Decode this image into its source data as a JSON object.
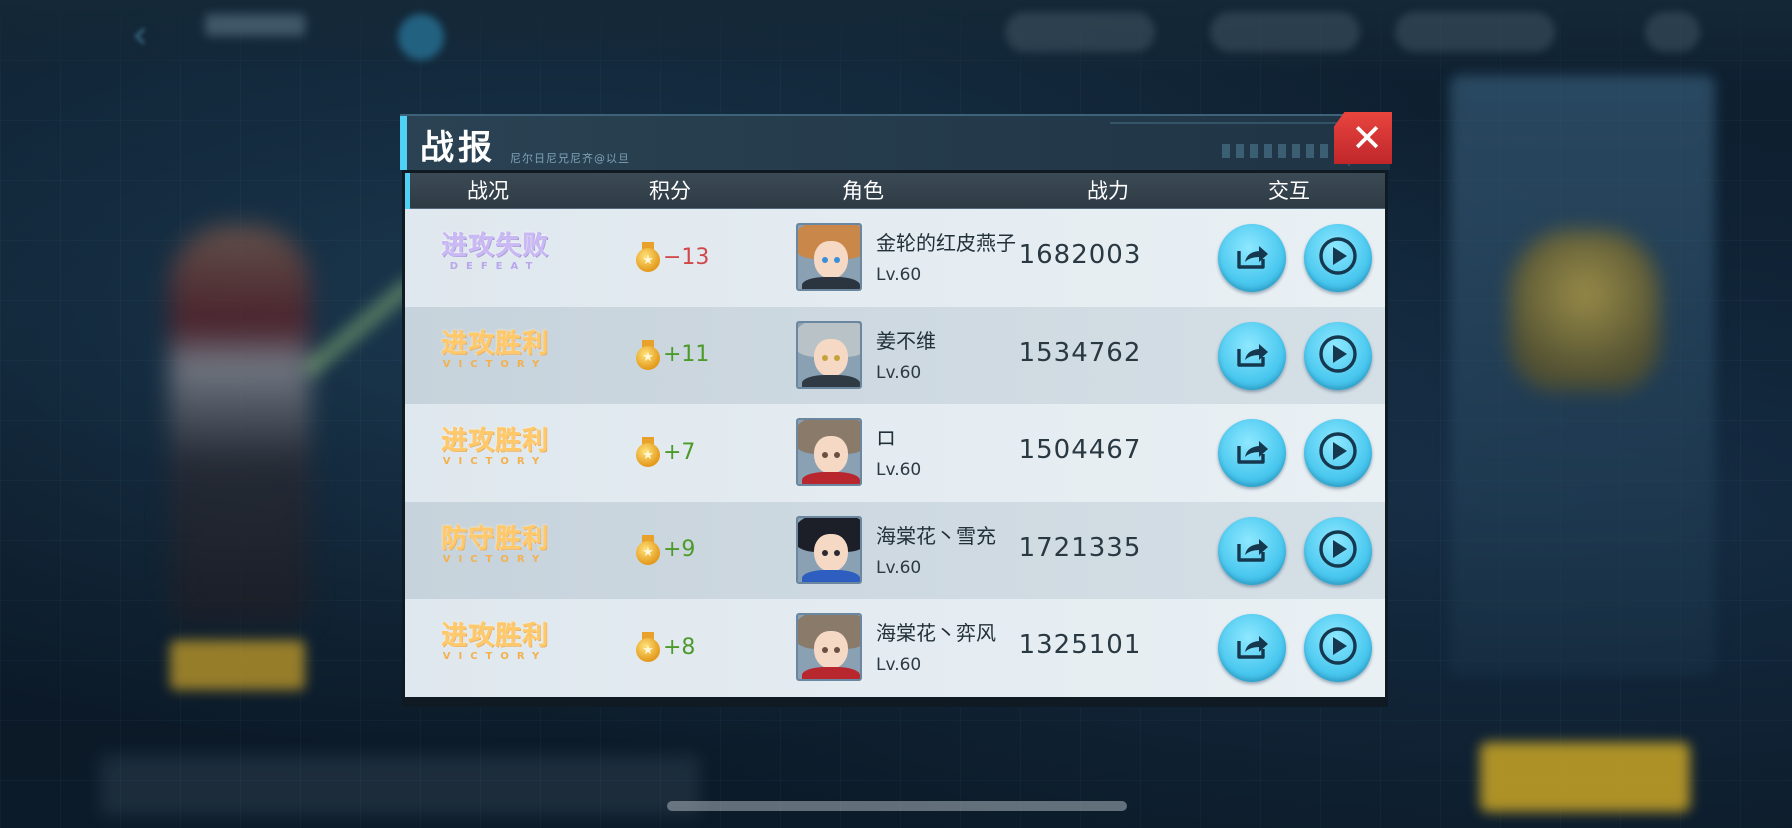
{
  "dialog": {
    "title": "战报",
    "subtitle": "尼尔日尼兄尼齐@以旦",
    "close_label": "✕"
  },
  "table": {
    "headers": [
      "战况",
      "积分",
      "角色",
      "战力",
      "交互"
    ],
    "rows": [
      {
        "result": "进攻失败",
        "result_sub": "DEFEAT",
        "result_type": "defeat",
        "score": "−13",
        "score_sign": "neg",
        "name": "金轮的红皮燕子",
        "level": "Lv.60",
        "power": "1682003",
        "avatar": {
          "hair": "#c9874a",
          "eye": "#3b8fd6",
          "body": "#2a3540"
        }
      },
      {
        "result": "进攻胜利",
        "result_sub": "VICTORY",
        "result_type": "victory",
        "score": "+11",
        "score_sign": "pos",
        "name": "姜不维",
        "level": "Lv.60",
        "power": "1534762",
        "avatar": {
          "hair": "#b9c2c6",
          "eye": "#c6a23a",
          "body": "#2f3a44"
        }
      },
      {
        "result": "进攻胜利",
        "result_sub": "VICTORY",
        "result_type": "victory",
        "score": "+7",
        "score_sign": "pos",
        "name": "ロ",
        "level": "Lv.60",
        "power": "1504467",
        "avatar": {
          "hair": "#8a7a6a",
          "eye": "#6a5040",
          "body": "#b8262e"
        }
      },
      {
        "result": "防守胜利",
        "result_sub": "VICTORY",
        "result_type": "victory",
        "score": "+9",
        "score_sign": "pos",
        "name": "海棠花丶雪充",
        "level": "Lv.60",
        "power": "1721335",
        "avatar": {
          "hair": "#1c1f28",
          "eye": "#2a2a30",
          "body": "#2e5fc0"
        }
      },
      {
        "result": "进攻胜利",
        "result_sub": "VICTORY",
        "result_type": "victory",
        "score": "+8",
        "score_sign": "pos",
        "name": "海棠花丶弈风",
        "level": "Lv.60",
        "power": "1325101",
        "avatar": {
          "hair": "#8a7a6a",
          "eye": "#6a5040",
          "body": "#b8262e"
        }
      }
    ]
  },
  "colors": {
    "accent": "#4fd1f5",
    "close": "#d8322f",
    "victory": "#ffc96a",
    "defeat": "#c9b8f4",
    "score_positive": "#4c9a2a",
    "score_negative": "#d2484a"
  },
  "icons": {
    "share": "share-icon",
    "replay": "play-icon",
    "score": "medal-icon",
    "close": "close-icon"
  }
}
